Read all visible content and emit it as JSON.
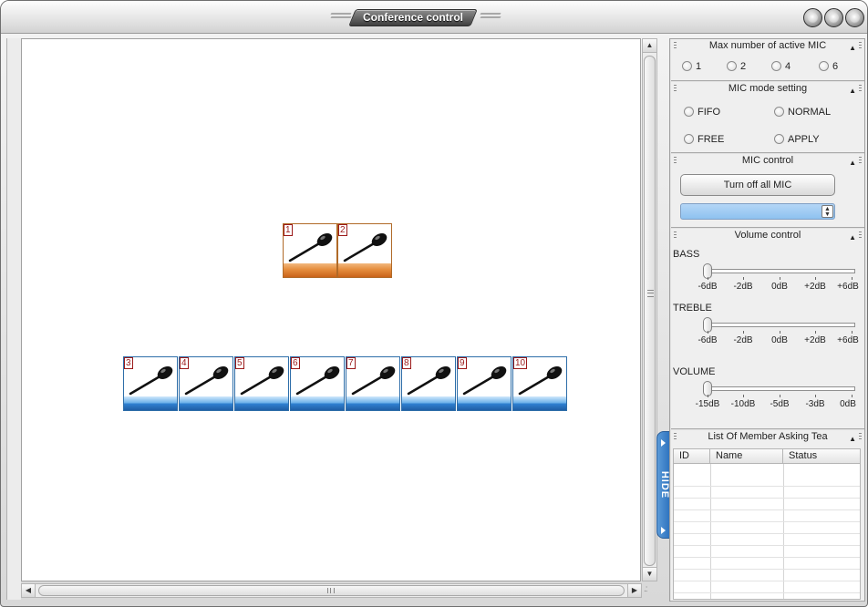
{
  "window": {
    "title": "Conference control",
    "controls": [
      "minimize-button",
      "maximize-button",
      "close-button"
    ]
  },
  "canvas": {
    "chairman_mics": [
      {
        "number": "1",
        "status": "chairman"
      },
      {
        "number": "2",
        "status": "chairman"
      }
    ],
    "delegate_mics": [
      {
        "number": "3"
      },
      {
        "number": "4"
      },
      {
        "number": "5"
      },
      {
        "number": "6"
      },
      {
        "number": "7"
      },
      {
        "number": "8"
      },
      {
        "number": "9"
      },
      {
        "number": "10"
      }
    ]
  },
  "hide_tab": {
    "label": "HIDE"
  },
  "panels": {
    "max_mic": {
      "title": "Max number of active MIC",
      "options": [
        "1",
        "2",
        "4",
        "6"
      ]
    },
    "mic_mode": {
      "title": "MIC mode setting",
      "options": [
        "FIFO",
        "NORMAL",
        "FREE",
        "APPLY"
      ]
    },
    "mic_control": {
      "title": "MIC control",
      "turn_off_label": "Turn off all MIC",
      "select_value": ""
    },
    "volume": {
      "title": "Volume control",
      "bass": {
        "label": "BASS",
        "ticks": [
          "-6dB",
          "-2dB",
          "0dB",
          "+2dB",
          "+6dB"
        ],
        "value": "-6dB"
      },
      "treble": {
        "label": "TREBLE",
        "ticks": [
          "-6dB",
          "-2dB",
          "0dB",
          "+2dB",
          "+6dB"
        ],
        "value": "-6dB"
      },
      "volume": {
        "label": "VOLUME",
        "ticks": [
          "-15dB",
          "-10dB",
          "-5dB",
          "-3dB",
          "0dB"
        ],
        "value": "-15dB"
      }
    },
    "member_list": {
      "title": "List Of Member Asking Tea",
      "columns": [
        "ID",
        "Name",
        "Status"
      ],
      "rows": []
    }
  },
  "colors": {
    "chairman_bar": "#e58d3d",
    "delegate_bar": "#2f7fcf",
    "hide_tab": "#3b82c9",
    "number_label": "#9b1a1a"
  },
  "icons": {
    "mic": "microphone-icon",
    "collapse": "collapse-up-icon",
    "grip": "drag-grip-icon"
  }
}
